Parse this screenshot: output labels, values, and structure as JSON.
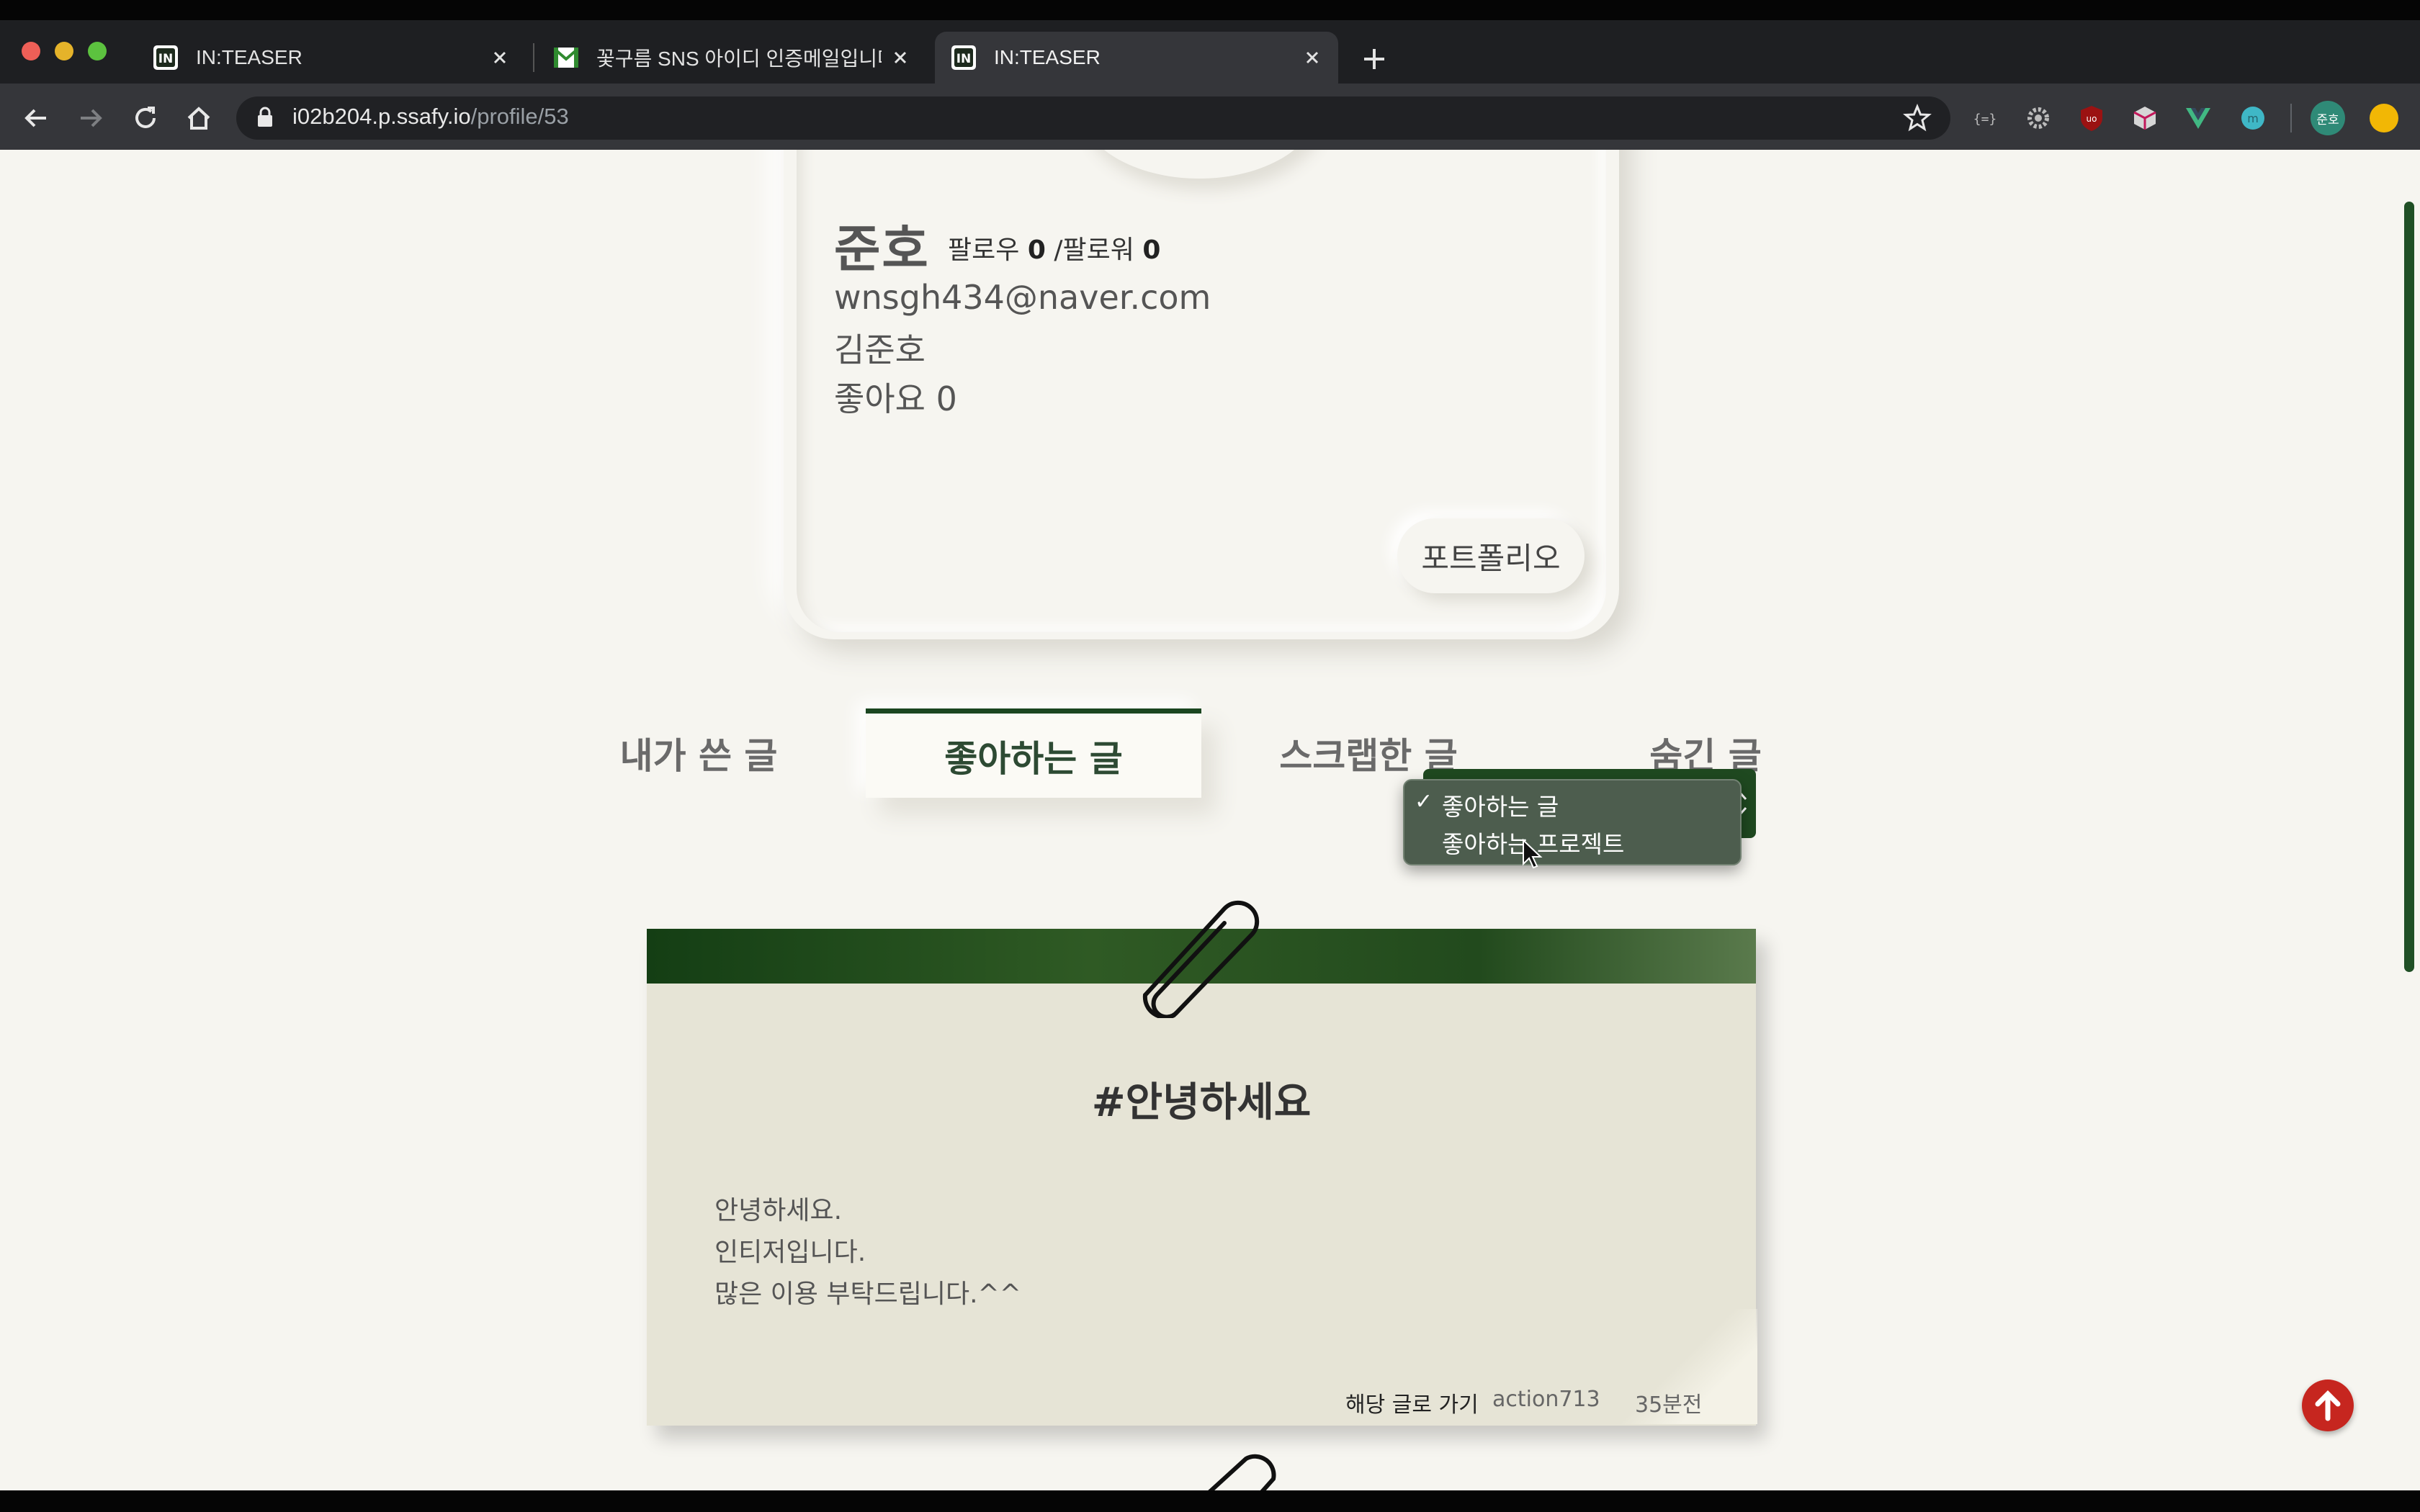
{
  "browser": {
    "tabs": [
      {
        "title": "IN:TEASER",
        "favicon": "inteaser-logo-icon",
        "active": false
      },
      {
        "title": "꽃구름 SNS 아이디 인증메일입니다.",
        "favicon": "gmail-icon",
        "active": false
      },
      {
        "title": "IN:TEASER",
        "favicon": "inteaser-logo-icon",
        "active": true
      }
    ],
    "url_host": "i02b204.p.ssafy.io",
    "url_path": "/profile/53",
    "profile_badge": "준호"
  },
  "profile": {
    "nickname": "준호",
    "follow_label": "팔로우",
    "follow_count": "0",
    "separator": "/",
    "follower_label": "팔로워",
    "follower_count": "0",
    "email": "wnsgh434@naver.com",
    "name": "김준호",
    "likes": "좋아요 0",
    "portfolio_button": "포트폴리오"
  },
  "tabs": [
    {
      "label": "내가 쓴 글",
      "active": false
    },
    {
      "label": "좋아하는 글",
      "active": true
    },
    {
      "label": "스크랩한 글",
      "active": false
    },
    {
      "label": "숨긴 글",
      "active": false
    }
  ],
  "filter_dropdown": {
    "options": [
      "좋아하는 글",
      "좋아하는 프로젝트"
    ],
    "selected": "좋아하는 글",
    "check_mark": "✓"
  },
  "post": {
    "title": "#안녕하세요",
    "lines": [
      "안녕하세요.",
      "인티저입니다.",
      "많은 이용 부탁드립니다.^^"
    ],
    "go_link": "해당 글로 가기",
    "author": "action713",
    "time": "35분전"
  },
  "colors": {
    "accent_green": "#1f4920",
    "page_bg": "#f6f5f0",
    "post_bg": "#e6e4d6",
    "top_button": "#c6261f"
  }
}
